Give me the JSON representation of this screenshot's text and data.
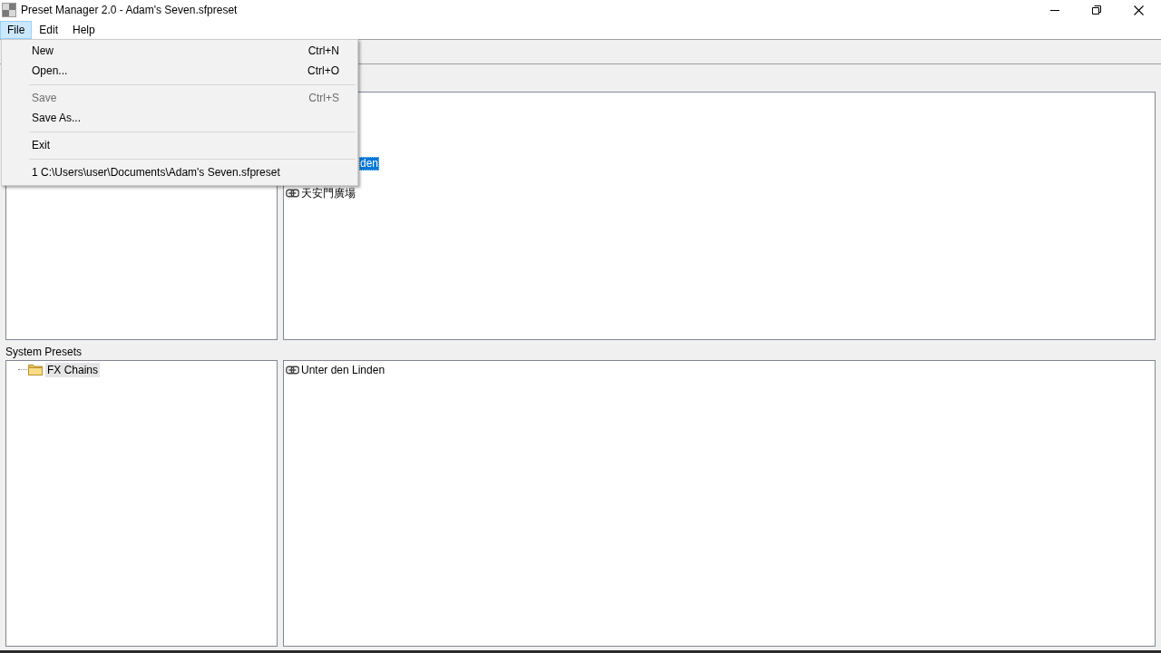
{
  "window": {
    "title": "Preset Manager 2.0 - Adam's Seven.sfpreset"
  },
  "menu_bar": [
    {
      "label": "File",
      "selected": true
    },
    {
      "label": "Edit",
      "selected": false
    },
    {
      "label": "Help",
      "selected": false
    }
  ],
  "file_menu": {
    "items": [
      {
        "kind": "item",
        "label": "New",
        "shortcut": "Ctrl+N",
        "disabled": false
      },
      {
        "kind": "item",
        "label": "Open...",
        "shortcut": "Ctrl+O",
        "disabled": false
      },
      {
        "kind": "separator"
      },
      {
        "kind": "item",
        "label": "Save",
        "shortcut": "Ctrl+S",
        "disabled": true
      },
      {
        "kind": "item",
        "label": "Save As...",
        "disabled": false
      },
      {
        "kind": "separator"
      },
      {
        "kind": "item",
        "label": "Exit",
        "disabled": false
      },
      {
        "kind": "separator"
      },
      {
        "kind": "item",
        "label": "1 C:\\Users\\user\\Documents\\Adam's Seven.sfpreset",
        "disabled": false
      }
    ]
  },
  "user_presets": {
    "list_items": [
      {
        "kind": "covered",
        "label": "den",
        "selected": true
      },
      {
        "kind": "preset",
        "label": "天安門廣場",
        "selected": false
      }
    ]
  },
  "system_presets": {
    "title": "System Presets",
    "tree": [
      {
        "label": "FX Chains",
        "selected": true
      }
    ],
    "list_items": [
      {
        "kind": "preset",
        "label": "Unter den Linden",
        "selected": false
      }
    ]
  }
}
